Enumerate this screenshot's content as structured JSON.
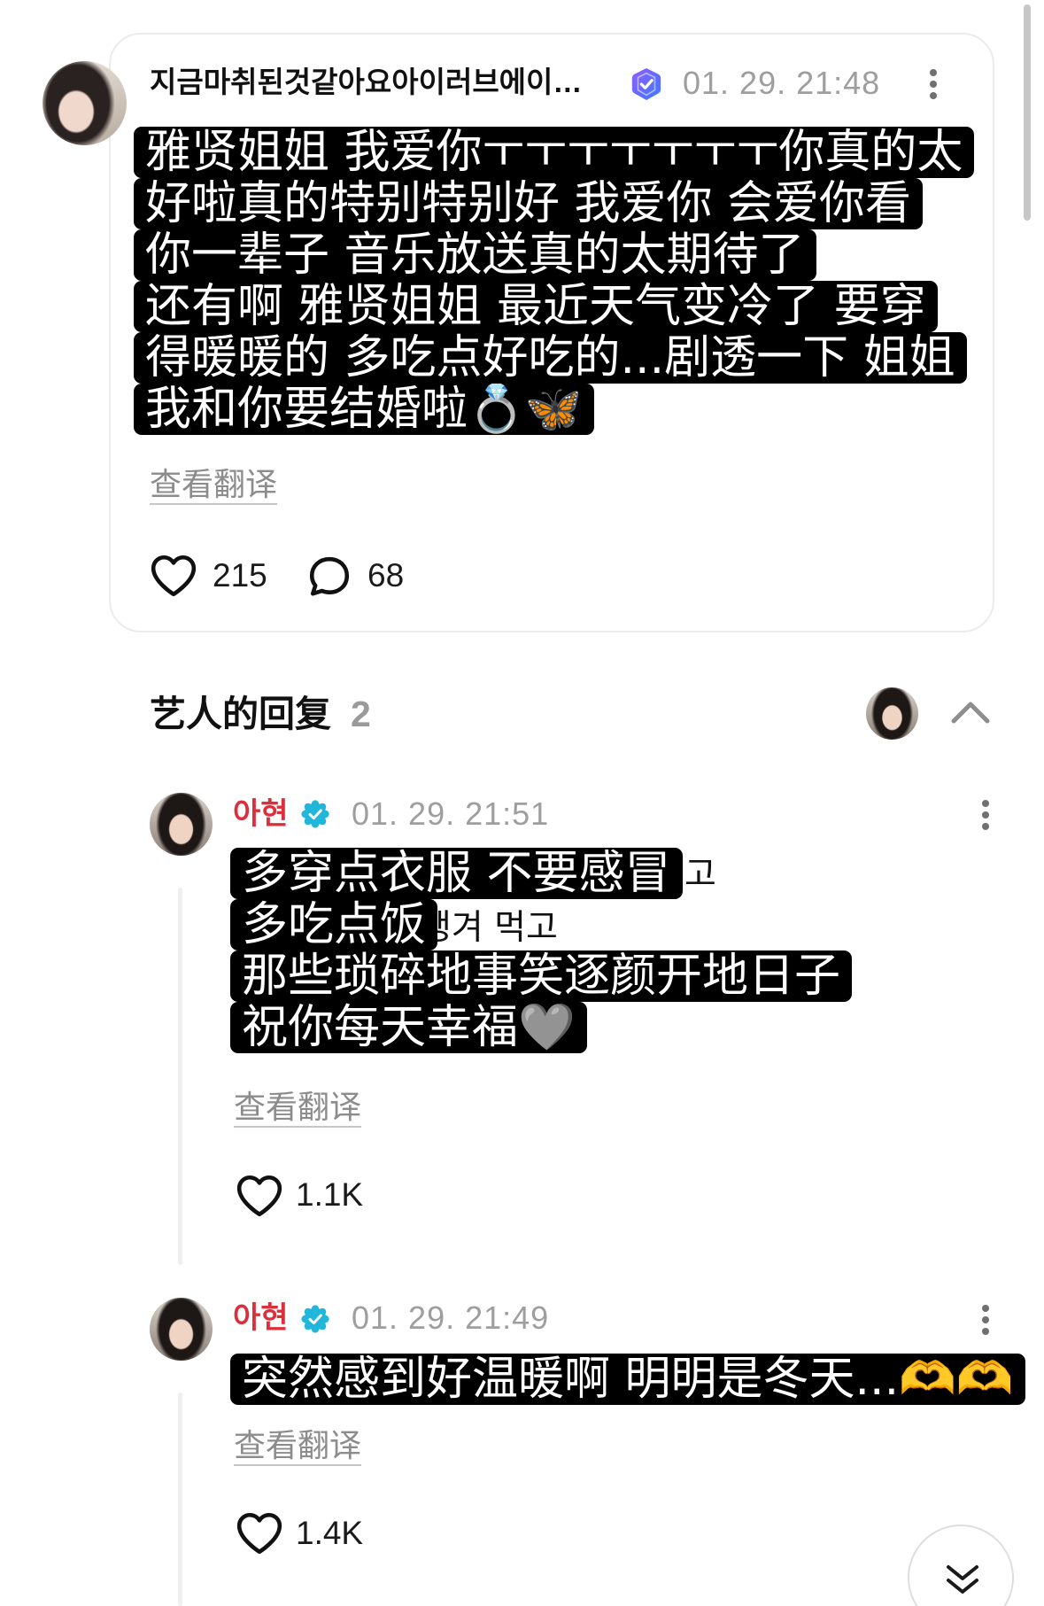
{
  "post": {
    "author": "지금마취된것같아요아이러브에이…",
    "timestamp": "01. 29. 21:48",
    "translation_lines": [
      "雅贤姐姐 我爱你ㅜㅜㅜㅜㅜㅜㅜ你真的太",
      "好啦真的特别特别好 我爱你 会爱你看",
      "你一辈子 音乐放送真的太期待了",
      "还有啊 雅贤姐姐 最近天气变冷了 要穿",
      "得暖暖的 多吃点好吃的...剧透一下 姐姐",
      "我和你要结婚啦💍🦋"
    ],
    "view_translation_label": "查看翻译",
    "like_count": "215",
    "comment_count": "68"
  },
  "artist_replies": {
    "title": "艺人的回复",
    "count": "2",
    "replies": [
      {
        "author": "아현",
        "timestamp": "01. 29. 21:51",
        "original_fragments": [
          "고",
          "챙겨 먹고"
        ],
        "translation_lines": [
          "多穿点衣服 不要感冒",
          "多吃点饭",
          "那些琐碎地事笑逐颜开地日子",
          "祝你每天幸福🩶"
        ],
        "view_translation_label": "查看翻译",
        "like_count": "1.1K"
      },
      {
        "author": "아현",
        "timestamp": "01. 29. 21:49",
        "translation_lines": [
          "突然感到好温暖啊 明明是冬天...🫶🫶"
        ],
        "view_translation_label": "查看翻译",
        "like_count": "1.4K"
      }
    ]
  },
  "icons": {
    "post_badge": "verified-shield-icon",
    "artist_badge": "artist-verified-icon",
    "more": "more-vertical-icon",
    "like": "heart-icon",
    "comment": "comment-bubble-icon",
    "collapse": "chevron-up-icon",
    "scroll_down": "double-chevron-down-icon"
  },
  "colors": {
    "artist_name": "#dc2f3c",
    "artist_badge": "#21b6da",
    "post_badge_start": "#8f5bff",
    "post_badge_end": "#3d7bff",
    "translation_box": "#000000",
    "muted_text": "#9e9e9e"
  }
}
